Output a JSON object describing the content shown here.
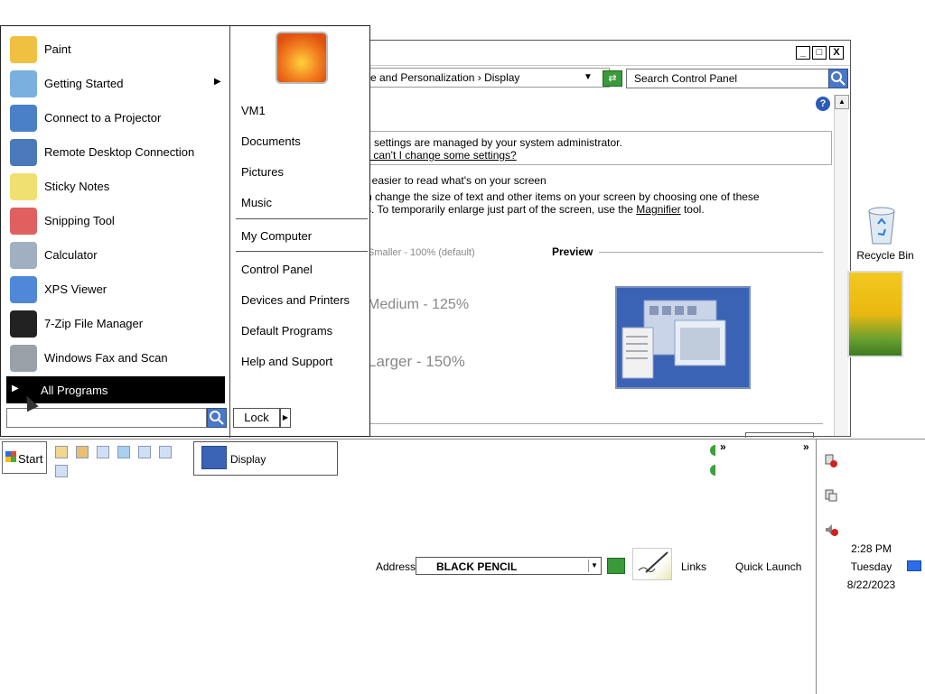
{
  "control_panel": {
    "breadcrumb": "e and Personalization  ›  Display",
    "search_placeholder": "Search Control Panel",
    "help_symbol": "?",
    "info_line1": "e settings are managed by your system administrator.",
    "info_line2": "y can't I change some settings?",
    "heading": ": easier to read what's on your screen",
    "desc_line1": "n change the size of text and other items on your screen by choosing one of these",
    "desc_line2_pre": "s. To temporarily enlarge just part of the screen, use the ",
    "desc_line2_link": "Magnifier",
    "desc_line2_post": " tool.",
    "options": {
      "smaller": "Smaller - 100% (default)",
      "medium": "Medium - 125%",
      "larger": "Larger - 150%"
    },
    "preview_label": "Preview",
    "window_buttons": {
      "minimize": "_",
      "maximize": "□",
      "close": "X"
    }
  },
  "desktop": {
    "recycle_bin_label": "Recycle Bin"
  },
  "start_menu": {
    "programs": [
      {
        "label": "Paint",
        "icon": "paint-icon",
        "has_submenu": false
      },
      {
        "label": "Getting Started",
        "icon": "getting-started-icon",
        "has_submenu": true
      },
      {
        "label": "Connect to a Projector",
        "icon": "projector-icon",
        "has_submenu": false
      },
      {
        "label": "Remote Desktop Connection",
        "icon": "remote-desktop-icon",
        "has_submenu": false
      },
      {
        "label": "Sticky Notes",
        "icon": "sticky-notes-icon",
        "has_submenu": false
      },
      {
        "label": "Snipping Tool",
        "icon": "snipping-tool-icon",
        "has_submenu": false
      },
      {
        "label": "Calculator",
        "icon": "calculator-icon",
        "has_submenu": false
      },
      {
        "label": "XPS Viewer",
        "icon": "xps-viewer-icon",
        "has_submenu": false
      },
      {
        "label": "7-Zip File Manager",
        "icon": "seven-zip-icon",
        "has_submenu": false
      },
      {
        "label": "Windows Fax and Scan",
        "icon": "fax-scan-icon",
        "has_submenu": false
      }
    ],
    "all_programs": "All Programs",
    "right_items_top": [
      "VM1",
      "Documents",
      "Pictures",
      "Music"
    ],
    "right_items_mid": [
      "My Computer"
    ],
    "right_items_bottom": [
      "Control Panel",
      "Devices and Printers",
      "Default Programs",
      "Help and Support"
    ],
    "lock_label": "Lock"
  },
  "taskbar": {
    "start_label": "Start",
    "task_display_label": "Display",
    "address_label": "Address",
    "address_value": "BLACK PENCIL",
    "links_label": "Links",
    "quick_launch_label": "Quick Launch",
    "chevron": "»",
    "clock": {
      "time": "2:28 PM",
      "day": "Tuesday",
      "date": "8/22/2023"
    }
  }
}
